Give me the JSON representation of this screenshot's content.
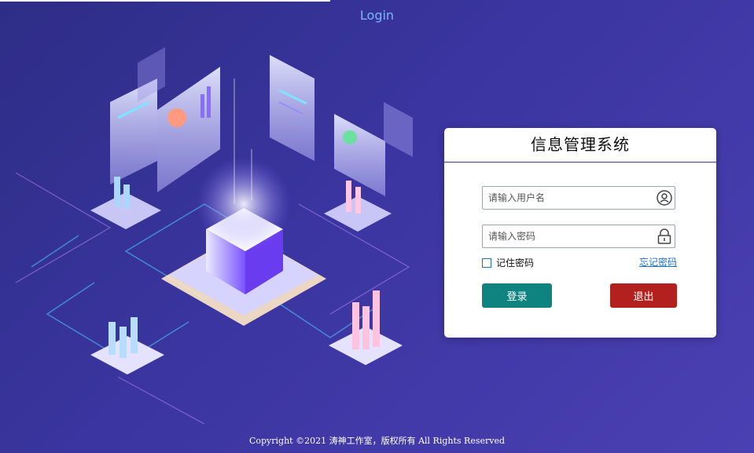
{
  "header": {
    "title": "Login"
  },
  "login_card": {
    "title": "信息管理系统",
    "username": {
      "placeholder": "请输入用户名",
      "value": ""
    },
    "password": {
      "placeholder": "请输入密码",
      "value": ""
    },
    "remember_label": "记住密码",
    "remember_checked": false,
    "forgot_label": "忘记密码",
    "login_label": "登录",
    "exit_label": "退出"
  },
  "footer": {
    "copyright": "Copyright ©2021 涛神工作室，版权所有 All Rights Reserved"
  },
  "icons": {
    "user": "user-circle-icon",
    "lock": "lock-icon"
  },
  "colors": {
    "background": "#3a35a0",
    "title_link": "#7fb2ff",
    "login_button": "#0f8380",
    "exit_button": "#b3211f",
    "forgot_link": "#1c72c9"
  }
}
